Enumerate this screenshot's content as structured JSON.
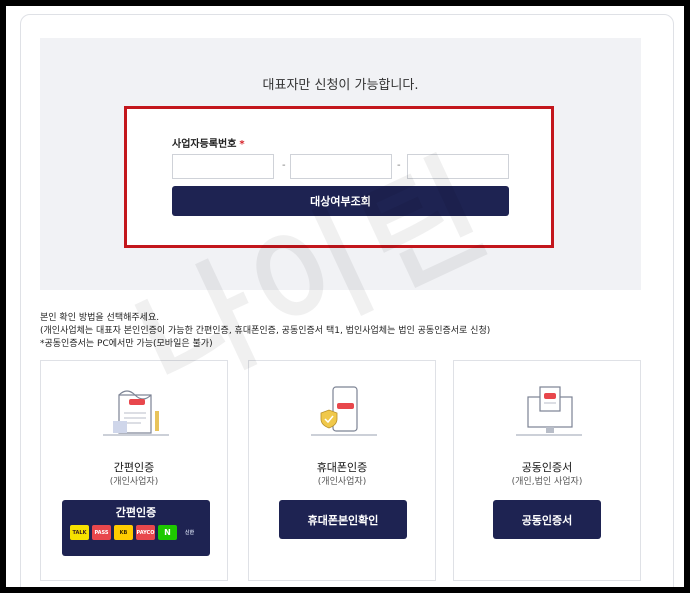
{
  "notice": "대표자만 신청이 가능합니다.",
  "form": {
    "label": "사업자등록번호",
    "required_mark": "*",
    "separator": "-",
    "submit_label": "대상여부조회"
  },
  "info_lines": [
    "본인 확인 방법을 선택해주세요.",
    "(개인사업체는 대표자 본인인증이 가능한 간편인증, 휴대폰인증, 공동인증서 택1, 법인사업체는 법인 공동인증서로 신청)",
    "*공동인증서는 PC에서만 가능(모바일은 불가)"
  ],
  "methods": [
    {
      "title": "간편인증",
      "subtitle": "(개인사업자)",
      "button_label": "간편인증",
      "providers": [
        "TALK",
        "PASS",
        "KB",
        "PAYCO",
        "N",
        "신한"
      ]
    },
    {
      "title": "휴대폰인증",
      "subtitle": "(개인사업자)",
      "button_label": "휴대폰본인확인"
    },
    {
      "title": "공동인증서",
      "subtitle": "(개인,법인 사업자)",
      "button_label": "공동인증서"
    }
  ],
  "watermark": "나이틴",
  "colors": {
    "primary": "#1e2352",
    "highlight": "#c3161c",
    "required": "#d6232a"
  }
}
